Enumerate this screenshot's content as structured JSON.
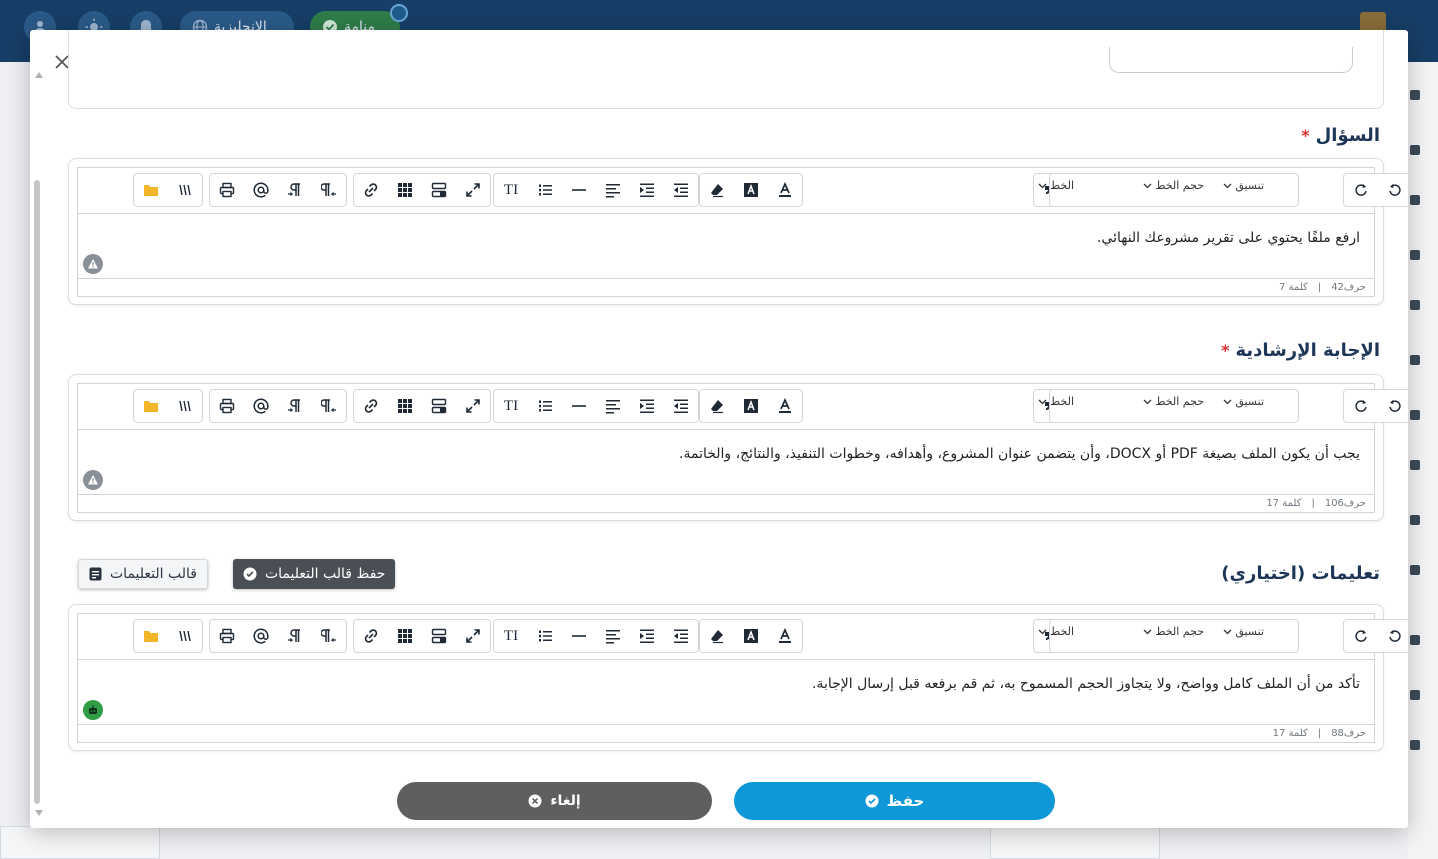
{
  "app": {
    "nav_pills": [
      "الإنجليزية",
      "منامة"
    ]
  },
  "colors": {
    "primary": "#0e98d8",
    "nav_bg": "#173e66",
    "required": "#e03131",
    "ok_badge": "#2f9e44"
  },
  "toolbar": {
    "font_label": "الخط",
    "size_label": "حجم الخط",
    "format_label": "تنسيق",
    "icons": [
      "redo-icon",
      "undo-icon",
      "blockquote-icon",
      "superscript-icon",
      "subscript-icon",
      "strikethrough-icon",
      "italic-icon",
      "underline-icon",
      "bold-icon",
      "clear-format-icon",
      "highlight-color-icon",
      "font-color-icon",
      "font-size-icon",
      "ordered-list-icon",
      "horizontal-rule-icon",
      "align-icon",
      "indent-icon",
      "outdent-icon",
      "unlink-icon",
      "table-icon",
      "template-icon",
      "fullscreen-icon",
      "print-icon",
      "mention-icon",
      "ltr-icon",
      "rtl-icon",
      "file-browser-icon",
      "preview-icon"
    ]
  },
  "question": {
    "title": "السؤال",
    "required_mark": "*",
    "text": "ارفع ملفًا يحتوي على تقرير مشروعك النهائي.",
    "chars": "حرف42",
    "separator": "|",
    "words": "كلمة 7"
  },
  "guidance": {
    "title": "الإجابة الإرشادية",
    "required_mark": "*",
    "text": "يجب أن يكون الملف بصيغة PDF أو DOCX، وأن يتضمن عنوان المشروع، وأهدافه، وخطوات التنفيذ، والنتائج، والخاتمة.",
    "chars": "حرف106",
    "separator": "|",
    "words": "كلمة 17"
  },
  "instructions": {
    "title": "تعليمات (اختياري)",
    "save_template_label": "حفظ قالب التعليمات",
    "template_label": "قالب التعليمات",
    "text": "تأكد من أن الملف كامل وواضح، ولا يتجاوز الحجم المسموح به، ثم قم برفعه قبل إرسال الإجابة.",
    "chars": "حرف88",
    "separator": "|",
    "words": "كلمة 17"
  },
  "footer": {
    "save_label": "حفظ",
    "cancel_label": "إلغاء"
  }
}
